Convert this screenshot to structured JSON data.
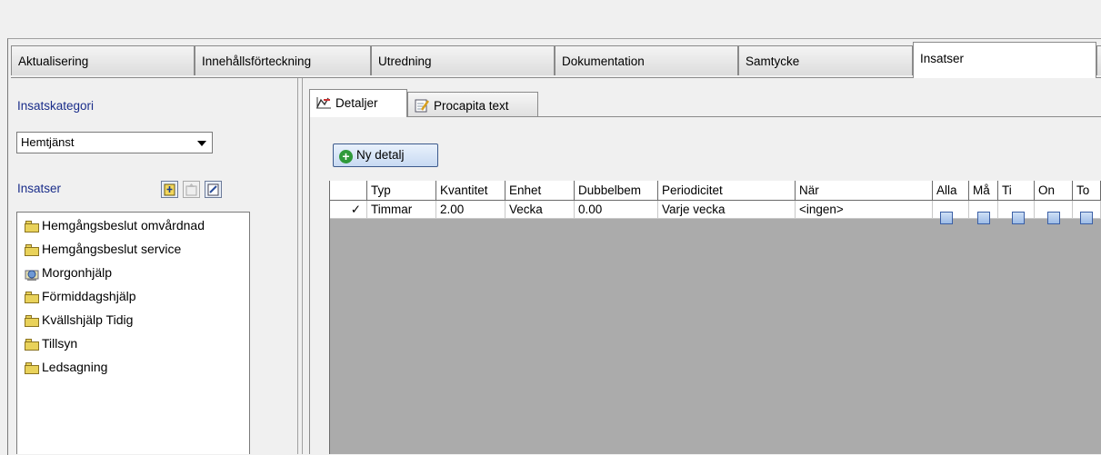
{
  "main_tabs": [
    {
      "label": "Aktualisering"
    },
    {
      "label": "Innehållsförteckning"
    },
    {
      "label": "Utredning"
    },
    {
      "label": "Dokumentation"
    },
    {
      "label": "Samtycke"
    },
    {
      "label": "Insatser"
    }
  ],
  "left": {
    "category_label": "Insatskategori",
    "category_value": "Hemtjänst",
    "insatser_label": "Insatser",
    "items": [
      {
        "label": "Hemgångsbeslut omvårdnad",
        "icon": "folder-icon"
      },
      {
        "label": "Hemgångsbeslut service",
        "icon": "folder-icon"
      },
      {
        "label": "Morgonhjälp",
        "icon": "network-folder-icon"
      },
      {
        "label": "Förmiddagshjälp",
        "icon": "folder-icon"
      },
      {
        "label": "Kvällshjälp Tidig",
        "icon": "folder-icon"
      },
      {
        "label": "Tillsyn",
        "icon": "folder-icon"
      },
      {
        "label": "Ledsagning",
        "icon": "folder-icon"
      }
    ]
  },
  "inner_tabs": [
    {
      "label": "Detaljer"
    },
    {
      "label": "Procapita text"
    }
  ],
  "new_detail_button": "Ny detalj",
  "grid": {
    "columns": [
      "",
      "Typ",
      "Kvantitet",
      "Enhet",
      "Dubbelbem",
      "Periodicitet",
      "När",
      "Alla",
      "Må",
      "Ti",
      "On",
      "To"
    ],
    "rows": [
      {
        "marker": "✓",
        "Typ": "Timmar",
        "Kvantitet": "2.00",
        "Enhet": "Vecka",
        "Dubbelbem": "0.00",
        "Periodicitet": "Varje vecka",
        "Nar": "<ingen>"
      }
    ]
  },
  "colors": {
    "accent_blue": "#1a2d8a",
    "folder": "#e9d25a",
    "grid_empty": "#ababab"
  }
}
